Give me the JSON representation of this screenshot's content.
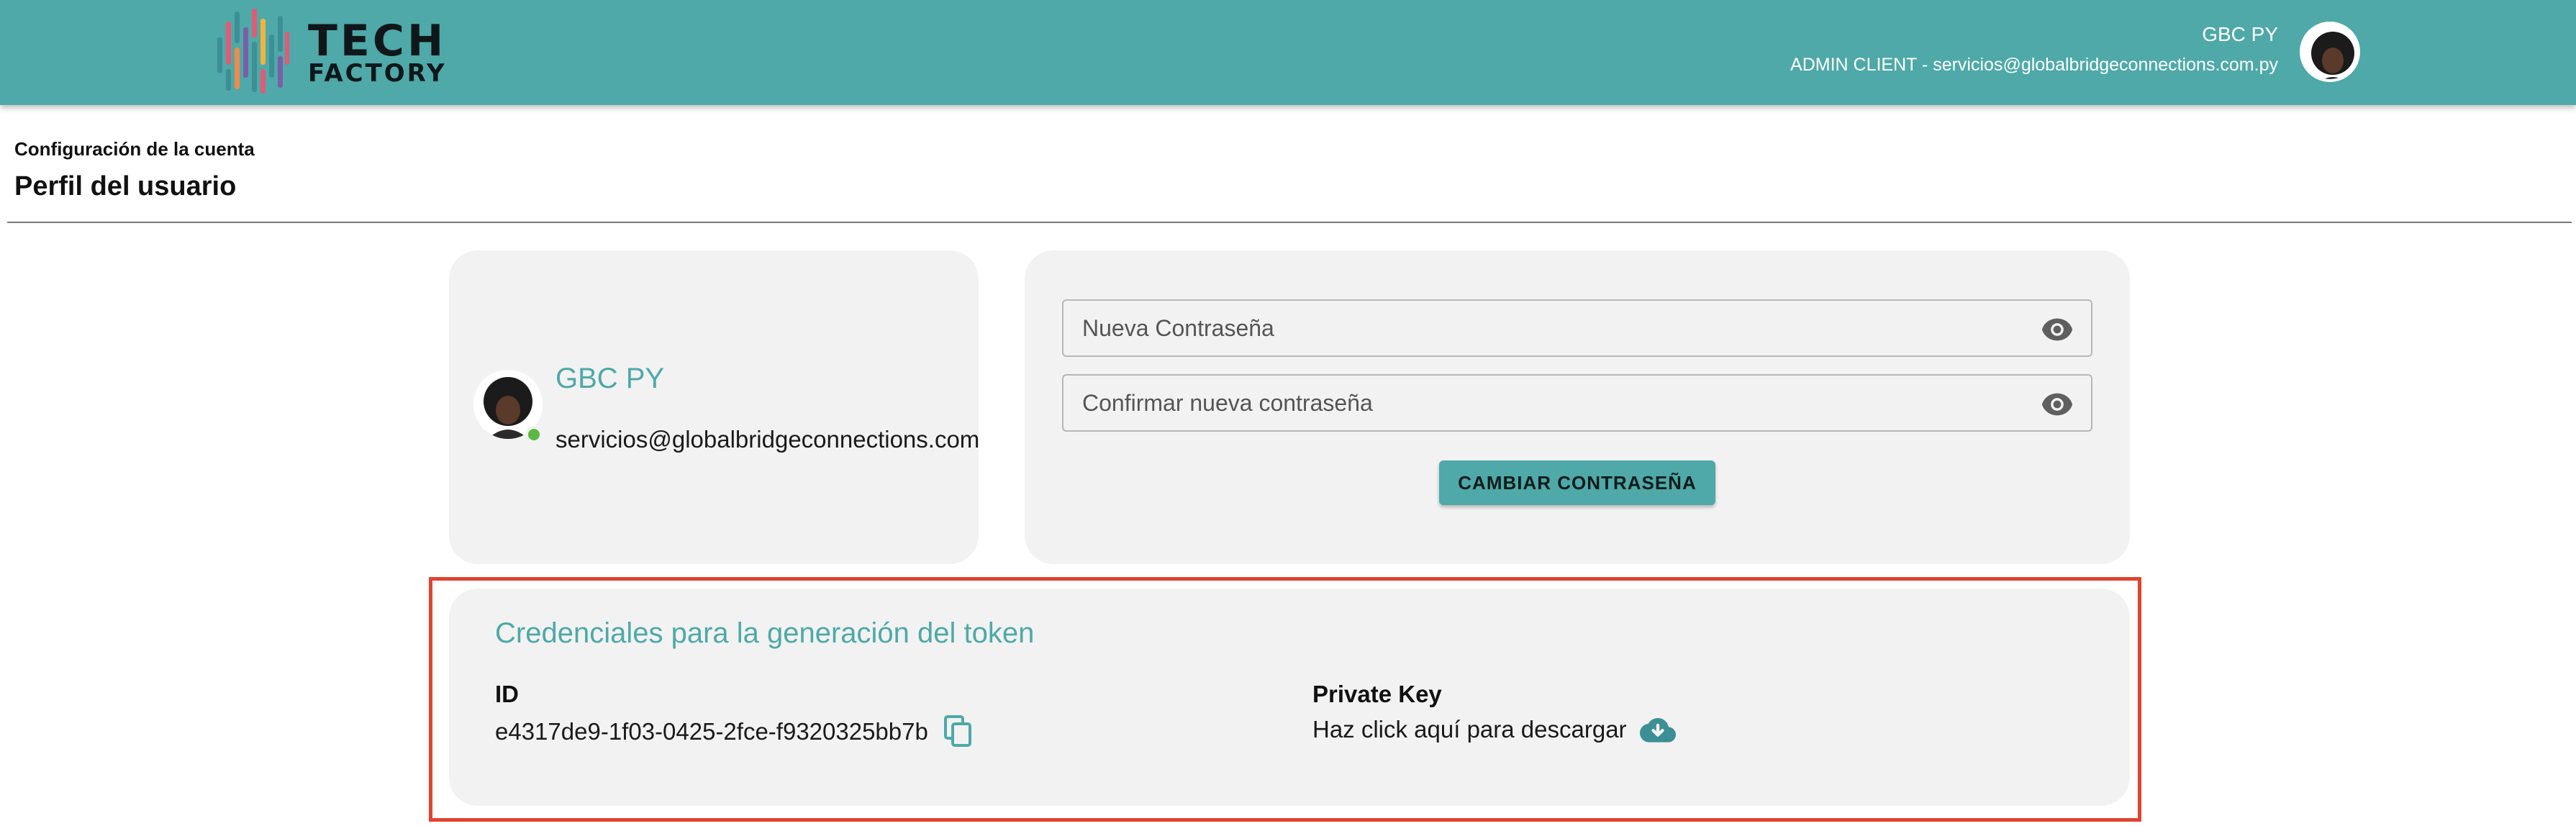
{
  "header": {
    "logo": {
      "line1": "TECH",
      "line2": "FACTORY"
    },
    "user_name": "GBC PY",
    "user_subtitle": "ADMIN CLIENT - servicios@globalbridgeconnections.com.py"
  },
  "page": {
    "breadcrumb": "Configuración de la cuenta",
    "title": "Perfil del usuario"
  },
  "profile": {
    "name": "GBC PY",
    "email": "servicios@globalbridgeconnections.com.py",
    "status": "online"
  },
  "password": {
    "new_placeholder": "Nueva Contraseña",
    "confirm_placeholder": "Confirmar nueva contraseña",
    "button_label": "CAMBIAR CONTRASEÑA"
  },
  "credentials": {
    "title": "Credenciales para la generación del token",
    "id_label": "ID",
    "id_value": "e4317de9-1f03-0425-2fce-f9320325bb7b",
    "key_label": "Private Key",
    "key_action": "Haz click aquí para descargar"
  },
  "colors": {
    "brand": "#4ea9a8",
    "card_bg": "#f2f2f2",
    "highlight": "#e0442f",
    "online": "#5ab843"
  },
  "icons": [
    "eye-icon",
    "copy-icon",
    "cloud-download-icon"
  ]
}
